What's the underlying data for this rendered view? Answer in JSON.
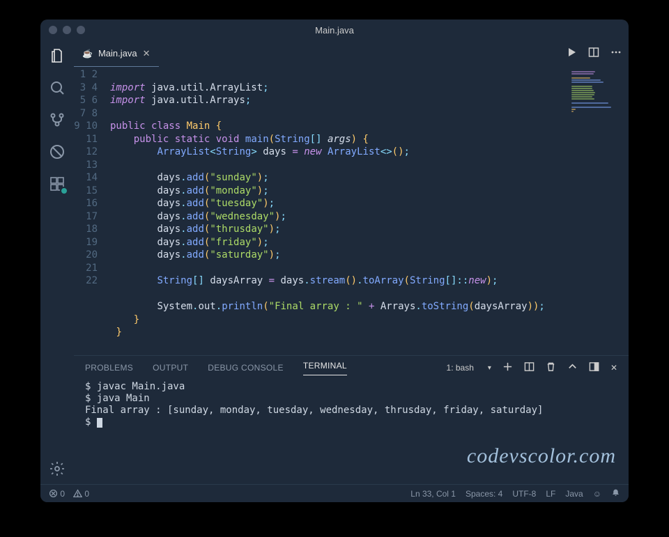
{
  "titlebar": {
    "title": "Main.java"
  },
  "tab": {
    "filename": "Main.java"
  },
  "activitybar": {
    "items": [
      "explorer",
      "search",
      "source-control",
      "debug",
      "extensions"
    ]
  },
  "editor_actions": [
    "run",
    "split",
    "more"
  ],
  "line_numbers": [
    "1",
    "2",
    "3",
    "4",
    "5",
    "6",
    "7",
    "8",
    "9",
    "10",
    "11",
    "12",
    "13",
    "14",
    "15",
    "16",
    "17",
    "18",
    "19",
    "20",
    "21",
    "22"
  ],
  "code": {
    "l2": {
      "import": "import",
      "pkg": "java.util.ArrayList"
    },
    "l3": {
      "import": "import",
      "pkg": "java.util.Arrays"
    },
    "l5": {
      "public": "public",
      "class": "class",
      "name": "Main"
    },
    "l6": {
      "public": "public",
      "static": "static",
      "void": "void",
      "main": "main",
      "String": "String",
      "args": "args"
    },
    "l7": {
      "ArrayList": "ArrayList",
      "String": "String",
      "days": "days",
      "new": "new",
      "ArrayList2": "ArrayList"
    },
    "l9": {
      "days": "days",
      "add": "add",
      "val": "\"sunday\""
    },
    "l10": {
      "days": "days",
      "add": "add",
      "val": "\"monday\""
    },
    "l11": {
      "days": "days",
      "add": "add",
      "val": "\"tuesday\""
    },
    "l12": {
      "days": "days",
      "add": "add",
      "val": "\"wednesday\""
    },
    "l13": {
      "days": "days",
      "add": "add",
      "val": "\"thrusday\""
    },
    "l14": {
      "days": "days",
      "add": "add",
      "val": "\"friday\""
    },
    "l15": {
      "days": "days",
      "add": "add",
      "val": "\"saturday\""
    },
    "l17": {
      "String": "String",
      "daysArray": "daysArray",
      "days": "days",
      "stream": "stream",
      "toArray": "toArray",
      "String2": "String",
      "new": "new"
    },
    "l19": {
      "System": "System",
      "out": "out",
      "println": "println",
      "text": "\"Final array : \"",
      "Arrays": "Arrays",
      "toString": "toString",
      "daysArray": "daysArray"
    }
  },
  "panel": {
    "tabs": {
      "problems": "PROBLEMS",
      "output": "OUTPUT",
      "debug": "DEBUG CONSOLE",
      "terminal": "TERMINAL"
    },
    "terminal_select": "1: bash"
  },
  "terminal": {
    "line1": "$ javac Main.java",
    "line2": "$ java Main",
    "line3": "Final array : [sunday, monday, tuesday, wednesday, thrusday, friday, saturday]",
    "line4_prefix": "$ "
  },
  "watermark": "codevscolor.com",
  "statusbar": {
    "errors": "0",
    "warnings": "0",
    "position": "Ln 33, Col 1",
    "spaces": "Spaces: 4",
    "encoding": "UTF-8",
    "eol": "LF",
    "language": "Java"
  }
}
